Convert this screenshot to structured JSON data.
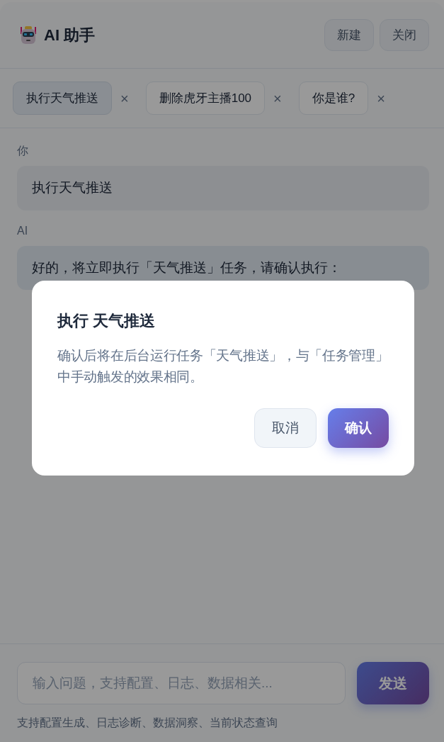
{
  "header": {
    "title": "AI 助手",
    "buttons": [
      "新建",
      "关闭"
    ]
  },
  "tabs": [
    {
      "label": "执行天气推送",
      "selected": true,
      "close": "×"
    },
    {
      "label": "删除虎牙主播100",
      "selected": false,
      "close": "×"
    },
    {
      "label": "你是谁?",
      "selected": false,
      "close": "×"
    }
  ],
  "messages": [
    {
      "kind": "user",
      "sender": "你",
      "text": "执行天气推送"
    },
    {
      "kind": "ai",
      "sender": "AI",
      "text": "好的，将立即执行「天气推送」任务，请确认执行："
    }
  ],
  "composer": {
    "placeholder": "输入问题，支持配置、日志、数据相关...",
    "send": "发送",
    "hint": "支持配置生成、日志诊断、数据洞察、当前状态查询"
  },
  "dialog": {
    "title": "执行 天气推送",
    "body": "确认后将在后台运行任务「天气推送」，与「任务管理」中手动触发的效果相同。",
    "buttons": [
      {
        "kind": "cancel",
        "label": "取消"
      },
      {
        "kind": "confirm",
        "label": "确认"
      }
    ]
  }
}
